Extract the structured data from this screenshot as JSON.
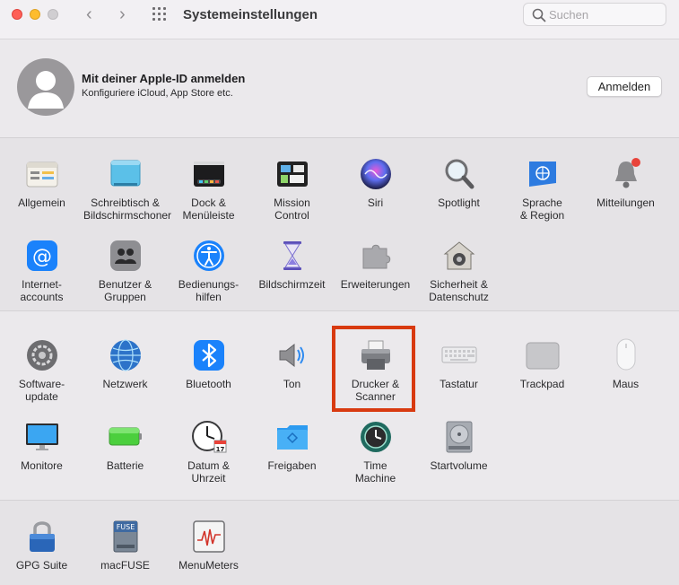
{
  "window": {
    "title": "Systemeinstellungen"
  },
  "search": {
    "placeholder": "Suchen"
  },
  "apple_id": {
    "title": "Mit deiner Apple-ID anmelden",
    "subtitle": "Konfiguriere iCloud, App Store etc.",
    "button": "Anmelden"
  },
  "section1": [
    {
      "label": "Allgemein",
      "icon": "general-icon"
    },
    {
      "label": "Schreibtisch &\nBildschirmschoner",
      "icon": "desktop-icon"
    },
    {
      "label": "Dock &\nMenüleiste",
      "icon": "dock-icon"
    },
    {
      "label": "Mission\nControl",
      "icon": "mission-control-icon"
    },
    {
      "label": "Siri",
      "icon": "siri-icon"
    },
    {
      "label": "Spotlight",
      "icon": "spotlight-icon"
    },
    {
      "label": "Sprache\n& Region",
      "icon": "language-region-icon"
    },
    {
      "label": "Mitteilungen",
      "icon": "notifications-icon"
    },
    {
      "label": "Internet-\naccounts",
      "icon": "internet-accounts-icon"
    },
    {
      "label": "Benutzer &\nGruppen",
      "icon": "users-groups-icon"
    },
    {
      "label": "Bedienungs-\nhilfen",
      "icon": "accessibility-icon"
    },
    {
      "label": "Bildschirmzeit",
      "icon": "screen-time-icon"
    },
    {
      "label": "Erweiterungen",
      "icon": "extensions-icon"
    },
    {
      "label": "Sicherheit &\nDatenschutz",
      "icon": "security-icon"
    }
  ],
  "section2": [
    {
      "label": "Software-\nupdate",
      "icon": "software-update-icon"
    },
    {
      "label": "Netzwerk",
      "icon": "network-icon"
    },
    {
      "label": "Bluetooth",
      "icon": "bluetooth-icon"
    },
    {
      "label": "Ton",
      "icon": "sound-icon"
    },
    {
      "label": "Drucker &\nScanner",
      "icon": "printer-icon"
    },
    {
      "label": "Tastatur",
      "icon": "keyboard-icon"
    },
    {
      "label": "Trackpad",
      "icon": "trackpad-icon"
    },
    {
      "label": "Maus",
      "icon": "mouse-icon"
    },
    {
      "label": "Monitore",
      "icon": "displays-icon"
    },
    {
      "label": "Batterie",
      "icon": "battery-icon"
    },
    {
      "label": "Datum &\nUhrzeit",
      "icon": "date-time-icon"
    },
    {
      "label": "Freigaben",
      "icon": "sharing-icon"
    },
    {
      "label": "Time\nMachine",
      "icon": "time-machine-icon"
    },
    {
      "label": "Startvolume",
      "icon": "startup-disk-icon"
    }
  ],
  "section3": [
    {
      "label": "GPG Suite",
      "icon": "gpg-suite-icon"
    },
    {
      "label": "macFUSE",
      "icon": "macfuse-icon"
    },
    {
      "label": "MenuMeters",
      "icon": "menumeters-icon"
    }
  ],
  "icon_text": {
    "macfuse": "FUSE",
    "calendar": "17"
  },
  "colors": {
    "highlight": "#d83a10",
    "accent": "#1a82fb"
  }
}
